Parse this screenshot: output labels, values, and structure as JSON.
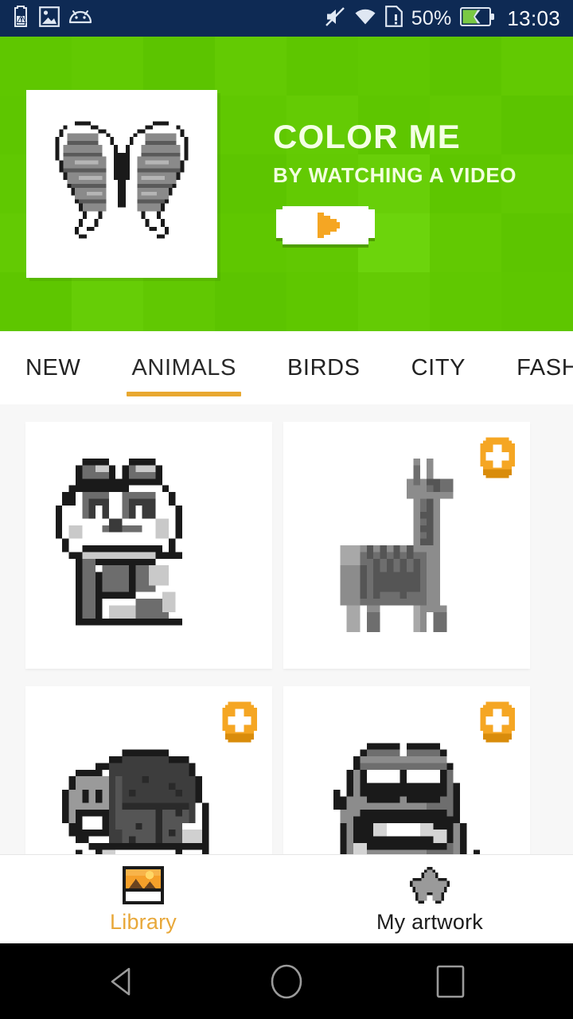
{
  "status_bar": {
    "background_color": "#0e2a54",
    "left_icons": [
      {
        "name": "battery-warning-icon"
      },
      {
        "name": "screenshot-image-icon"
      },
      {
        "name": "android-head-icon"
      }
    ],
    "right_icons": [
      {
        "name": "volume-mute-icon"
      },
      {
        "name": "wifi-icon"
      },
      {
        "name": "sim-card-alert-icon"
      }
    ],
    "battery_percent": "50%",
    "battery_color": "#7ac943",
    "clock": "13:03"
  },
  "banner": {
    "title": "COLOR ME",
    "subtitle": "BY WATCHING A VIDEO",
    "background_color": "#5fc700",
    "thumbnail_name": "butterfly-pixel-art",
    "play_button_label": "play-video-button",
    "play_icon_color": "#f5a623"
  },
  "tabs": {
    "accent_color": "#e8a830",
    "items": [
      {
        "label": "NEW",
        "active": false
      },
      {
        "label": "ANIMALS",
        "active": true
      },
      {
        "label": "BIRDS",
        "active": false
      },
      {
        "label": "CITY",
        "active": false
      },
      {
        "label": "FASHION",
        "active": false
      }
    ]
  },
  "grid": {
    "badge_color": "#f5a623",
    "rows": [
      [
        {
          "name": "panda",
          "badge": false
        },
        {
          "name": "llama",
          "badge": true
        }
      ],
      [
        {
          "name": "turtle",
          "badge": true
        },
        {
          "name": "frog",
          "badge": true
        }
      ]
    ]
  },
  "bottom_nav": {
    "active_color": "#e8a83a",
    "items": [
      {
        "label": "Library",
        "icon": "picture-frame-icon",
        "active": true
      },
      {
        "label": "My artwork",
        "icon": "star-icon",
        "active": false
      }
    ]
  },
  "nav_bar": {
    "back_label": "back-button",
    "home_label": "home-button",
    "recents_label": "recents-button"
  }
}
